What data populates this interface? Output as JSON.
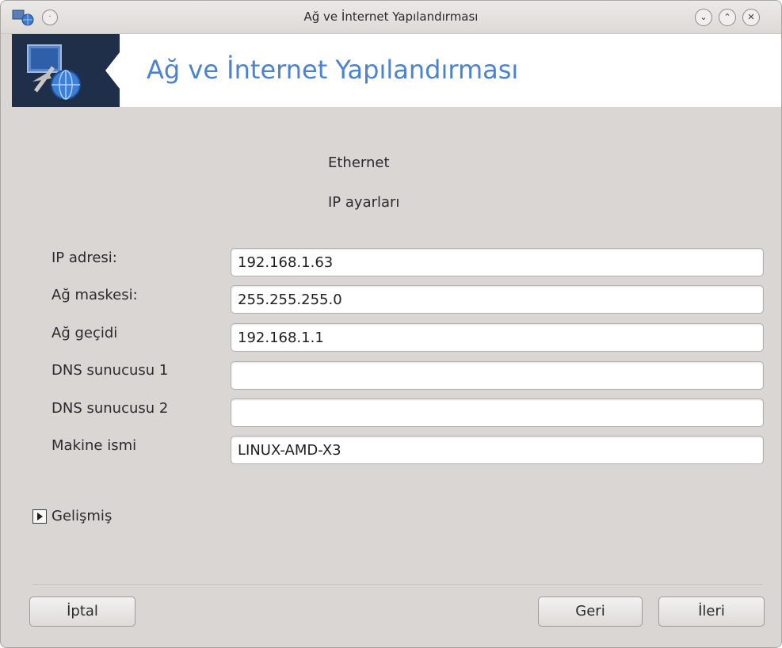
{
  "window": {
    "title": "Ağ ve İnternet Yapılandırması",
    "menu_icon": "circle-dot-icon",
    "minimize_icon": "chevron-down-icon",
    "maximize_icon": "chevron-up-icon",
    "close_icon": "close-icon"
  },
  "header": {
    "title": "Ağ ve İnternet Yapılandırması",
    "accent_color": "#4a83cf",
    "logo_bg": "#1f2f4a"
  },
  "content": {
    "connection_type": "Ethernet",
    "section_title": "IP ayarları",
    "fields": [
      {
        "label": "IP adresi:",
        "value": "192.168.1.63"
      },
      {
        "label": "Ağ maskesi:",
        "value": "255.255.255.0"
      },
      {
        "label": "Ağ geçidi",
        "value": "192.168.1.1"
      },
      {
        "label": "DNS sunucusu 1",
        "value": ""
      },
      {
        "label": "DNS sunucusu 2",
        "value": ""
      },
      {
        "label": "Makine ismi",
        "value": "LINUX-AMD-X3"
      }
    ],
    "advanced_label": "Gelişmiş"
  },
  "footer": {
    "cancel": "İptal",
    "back": "Geri",
    "next": "İleri"
  }
}
